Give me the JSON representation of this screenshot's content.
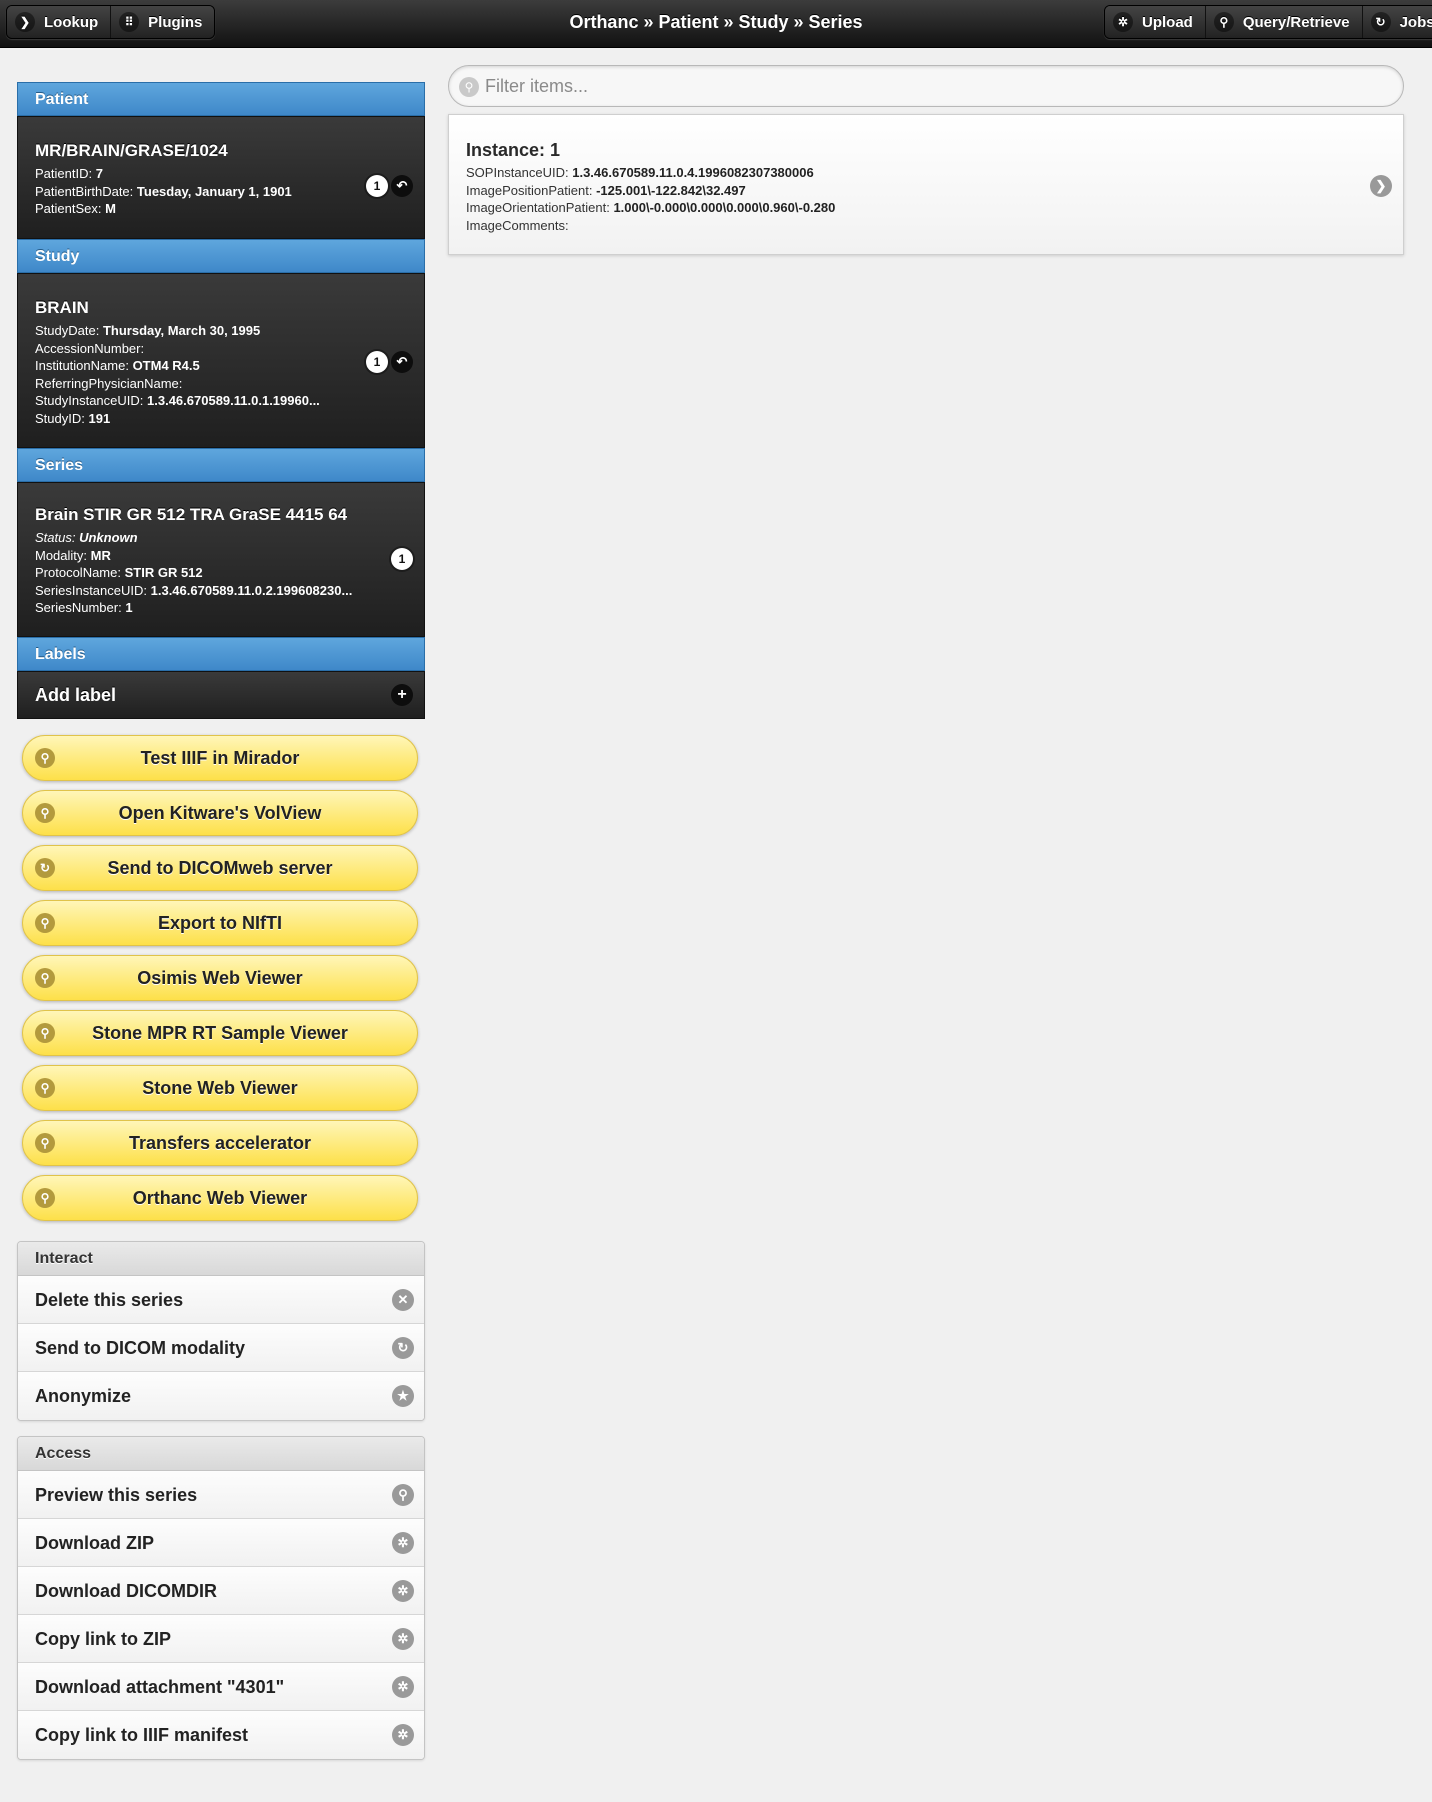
{
  "header": {
    "left_buttons": [
      {
        "label": "Lookup",
        "icon": "chevron-right-icon",
        "glyph": "❯"
      },
      {
        "label": "Plugins",
        "icon": "grid-icon",
        "glyph": "⠿"
      }
    ],
    "title": "Orthanc » Patient » Study » Series",
    "right_buttons": [
      {
        "label": "Upload",
        "icon": "gear-icon",
        "glyph": "✲"
      },
      {
        "label": "Query/Retrieve",
        "icon": "search-icon",
        "glyph": "⚲"
      },
      {
        "label": "Jobs",
        "icon": "refresh-icon",
        "glyph": "↻"
      }
    ]
  },
  "patient": {
    "band": "Patient",
    "name": "MR/BRAIN/GRASE/1024",
    "fields": [
      {
        "key": "PatientID:",
        "value": "7"
      },
      {
        "key": "PatientBirthDate:",
        "value": "Tuesday, January 1, 1901"
      },
      {
        "key": "PatientSex:",
        "value": "M"
      }
    ],
    "badge": "1"
  },
  "study": {
    "band": "Study",
    "name": "BRAIN",
    "fields": [
      {
        "key": "StudyDate:",
        "value": "Thursday, March 30, 1995"
      },
      {
        "key": "AccessionNumber:",
        "value": ""
      },
      {
        "key": "InstitutionName:",
        "value": "OTM4 R4.5"
      },
      {
        "key": "ReferringPhysicianName:",
        "value": ""
      },
      {
        "key": "StudyInstanceUID:",
        "value": "1.3.46.670589.11.0.1.19960..."
      },
      {
        "key": "StudyID:",
        "value": "191"
      }
    ],
    "badge": "1"
  },
  "series": {
    "band": "Series",
    "name": "Brain STIR GR 512 TRA GraSE 4415 64",
    "status_key": "Status:",
    "status_value": "Unknown",
    "fields": [
      {
        "key": "Modality:",
        "value": "MR"
      },
      {
        "key": "ProtocolName:",
        "value": "STIR GR 512"
      },
      {
        "key": "SeriesInstanceUID:",
        "value": "1.3.46.670589.11.0.2.199608230..."
      },
      {
        "key": "SeriesNumber:",
        "value": "1"
      }
    ],
    "badge": "1"
  },
  "labels": {
    "band": "Labels",
    "add_label": "Add label"
  },
  "plugin_buttons": [
    {
      "label": "Test IIIF in Mirador",
      "icon": "search-icon"
    },
    {
      "label": "Open Kitware's VolView",
      "icon": "search-icon"
    },
    {
      "label": "Send to DICOMweb server",
      "icon": "send-icon"
    },
    {
      "label": "Export to NIfTI",
      "icon": "search-icon"
    },
    {
      "label": "Osimis Web Viewer",
      "icon": "search-icon"
    },
    {
      "label": "Stone MPR RT Sample Viewer",
      "icon": "search-icon"
    },
    {
      "label": "Stone Web Viewer",
      "icon": "search-icon"
    },
    {
      "label": "Transfers accelerator",
      "icon": "search-icon"
    },
    {
      "label": "Orthanc Web Viewer",
      "icon": "search-icon"
    }
  ],
  "interact": {
    "title": "Interact",
    "items": [
      {
        "label": "Delete this series",
        "icon": "delete-icon",
        "glyph": "✕"
      },
      {
        "label": "Send to DICOM modality",
        "icon": "send-icon",
        "glyph": "↻"
      },
      {
        "label": "Anonymize",
        "icon": "star-icon",
        "glyph": "★"
      }
    ]
  },
  "access": {
    "title": "Access",
    "items": [
      {
        "label": "Preview this series",
        "icon": "search-icon",
        "glyph": "⚲"
      },
      {
        "label": "Download ZIP",
        "icon": "gear-icon",
        "glyph": "✲"
      },
      {
        "label": "Download DICOMDIR",
        "icon": "gear-icon",
        "glyph": "✲"
      },
      {
        "label": "Copy link to ZIP",
        "icon": "gear-icon",
        "glyph": "✲"
      },
      {
        "label": "Download attachment \"4301\"",
        "icon": "gear-icon",
        "glyph": "✲"
      },
      {
        "label": "Copy link to IIIF manifest",
        "icon": "gear-icon",
        "glyph": "✲"
      }
    ]
  },
  "filter": {
    "placeholder": "Filter items..."
  },
  "instance": {
    "title": "Instance: 1",
    "fields": [
      {
        "key": "SOPInstanceUID:",
        "value": "1.3.46.670589.11.0.4.1996082307380006"
      },
      {
        "key": "ImagePositionPatient:",
        "value": "-125.001\\-122.842\\32.497"
      },
      {
        "key": "ImageOrientationPatient:",
        "value": "1.000\\-0.000\\0.000\\0.000\\0.960\\-0.280"
      },
      {
        "key": "ImageComments:",
        "value": ""
      }
    ]
  }
}
